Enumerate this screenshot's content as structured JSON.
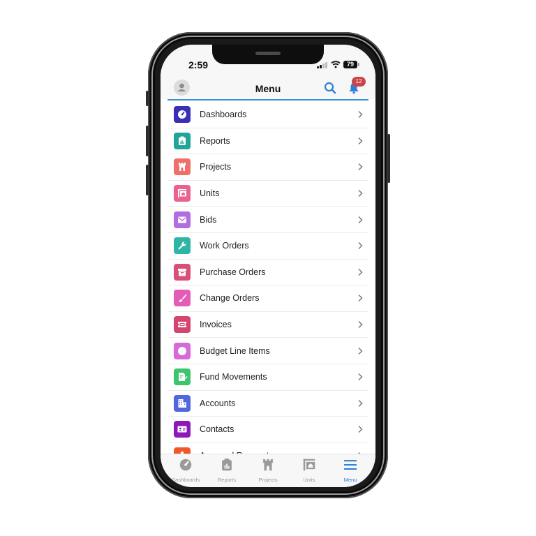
{
  "status_bar": {
    "time": "2:59",
    "battery": "79"
  },
  "header": {
    "title": "Menu",
    "notification_count": "12"
  },
  "colors": {
    "accent": "#2d7fd4",
    "badge": "#c9454b",
    "inactive_tab": "#9a9a9a"
  },
  "menu_items": [
    {
      "label": "Dashboards",
      "icon": "gauge-icon",
      "color": "#3a2fb7"
    },
    {
      "label": "Reports",
      "icon": "clipboard-chart-icon",
      "color": "#1fa59a"
    },
    {
      "label": "Projects",
      "icon": "castle-icon",
      "color": "#ef6f6a"
    },
    {
      "label": "Units",
      "icon": "unit-sign-icon",
      "color": "#e9638e"
    },
    {
      "label": "Bids",
      "icon": "envelope-icon",
      "color": "#b06ee0"
    },
    {
      "label": "Work Orders",
      "icon": "wrench-icon",
      "color": "#2fb5a6"
    },
    {
      "label": "Purchase Orders",
      "icon": "archive-box-icon",
      "color": "#d94f78"
    },
    {
      "label": "Change Orders",
      "icon": "brush-icon",
      "color": "#e55bb8"
    },
    {
      "label": "Invoices",
      "icon": "ticket-icon",
      "color": "#d5456d"
    },
    {
      "label": "Budget Line Items",
      "icon": "circle-icon",
      "color": "#d66ad6"
    },
    {
      "label": "Fund Movements",
      "icon": "document-edit-icon",
      "color": "#3cc46e"
    },
    {
      "label": "Accounts",
      "icon": "building-icon",
      "color": "#5266e0"
    },
    {
      "label": "Contacts",
      "icon": "id-card-icon",
      "color": "#8e17b8"
    },
    {
      "label": "Approval Requests",
      "icon": "stamp-icon",
      "color": "#f0582c"
    }
  ],
  "tabs": [
    {
      "label": "Dashboards",
      "icon": "gauge-icon",
      "active": false
    },
    {
      "label": "Reports",
      "icon": "clipboard-chart-icon",
      "active": false
    },
    {
      "label": "Projects",
      "icon": "castle-icon",
      "active": false
    },
    {
      "label": "Units",
      "icon": "unit-sign-icon",
      "active": false
    },
    {
      "label": "Menu",
      "icon": "hamburger-icon",
      "active": true
    }
  ]
}
